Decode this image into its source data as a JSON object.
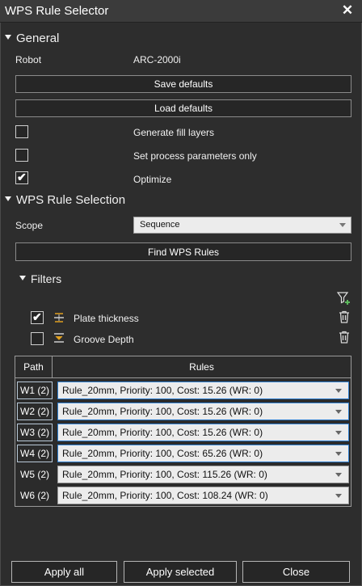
{
  "window": {
    "title": "WPS Rule Selector"
  },
  "general": {
    "header": "General",
    "robot_label": "Robot",
    "robot_value": "ARC-2000i",
    "save_defaults": "Save defaults",
    "load_defaults": "Load defaults",
    "options": [
      {
        "label": "Generate fill layers",
        "checked": false
      },
      {
        "label": "Set process parameters only",
        "checked": false
      },
      {
        "label": "Optimize",
        "checked": true
      }
    ]
  },
  "wps": {
    "header": "WPS Rule Selection",
    "scope_label": "Scope",
    "scope_value": "Sequence",
    "find_button": "Find WPS Rules"
  },
  "filters": {
    "header": "Filters",
    "items": [
      {
        "label": "Plate thickness",
        "checked": true
      },
      {
        "label": "Groove Depth",
        "checked": false
      }
    ]
  },
  "table": {
    "columns": [
      "Path",
      "Rules"
    ],
    "rows": [
      {
        "path": "W1 (2)",
        "rule": "Rule_20mm, Priority: 100, Cost: 15.26 (WR: 0)",
        "selected": true
      },
      {
        "path": "W2 (2)",
        "rule": "Rule_20mm, Priority: 100, Cost: 15.26 (WR: 0)",
        "selected": true
      },
      {
        "path": "W3 (2)",
        "rule": "Rule_20mm, Priority: 100, Cost: 15.26 (WR: 0)",
        "selected": true
      },
      {
        "path": "W4 (2)",
        "rule": "Rule_20mm, Priority: 100, Cost: 65.26 (WR: 0)",
        "selected": true
      },
      {
        "path": "W5 (2)",
        "rule": "Rule_20mm, Priority: 100, Cost: 115.26 (WR: 0)",
        "selected": false
      },
      {
        "path": "W6 (2)",
        "rule": "Rule_20mm, Priority: 100, Cost: 108.24 (WR: 0)",
        "selected": false
      }
    ]
  },
  "footer": {
    "apply_all": "Apply all",
    "apply_selected": "Apply selected",
    "close": "Close"
  },
  "icons": {
    "close": "close-icon",
    "filter_add": "filter-add-icon",
    "trash": "trash-icon",
    "plate_thickness": "plate-thickness-icon",
    "groove_depth": "groove-depth-icon"
  },
  "colors": {
    "background": "#2d2d2d",
    "titlebar": "#3b3b3b",
    "selection_border": "#2f7fd0",
    "filter_add_accent": "#5cb85c",
    "filter_icon_accent": "#e0a020"
  }
}
